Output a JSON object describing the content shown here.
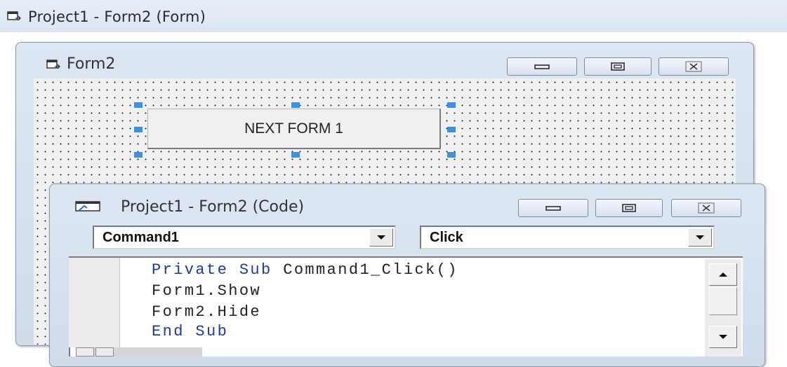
{
  "ide": {
    "window_title": "Project1 - Form2 (Form)"
  },
  "form_window": {
    "title": "Form2",
    "command_button": {
      "caption": "NEXT FORM 1"
    }
  },
  "code_window": {
    "title": "Project1 - Form2 (Code)",
    "object_combo": "Command1",
    "procedure_combo": "Click",
    "code_lines": [
      {
        "keyword": "Private Sub",
        "rest": " Command1_Click()"
      },
      {
        "keyword": "",
        "rest": "Form1.Show"
      },
      {
        "keyword": "",
        "rest": "Form2.Hide"
      },
      {
        "keyword": "End Sub",
        "rest": ""
      }
    ]
  },
  "colors": {
    "selection_handle": "#3a92e6",
    "keyword": "#1f3a9a",
    "title_bar": "#dbe6f3"
  },
  "icons": [
    "form-icon",
    "code-window-icon",
    "minimize-icon",
    "maximize-icon",
    "close-icon",
    "dropdown-arrow-icon",
    "scroll-up-icon",
    "scroll-down-icon"
  ]
}
